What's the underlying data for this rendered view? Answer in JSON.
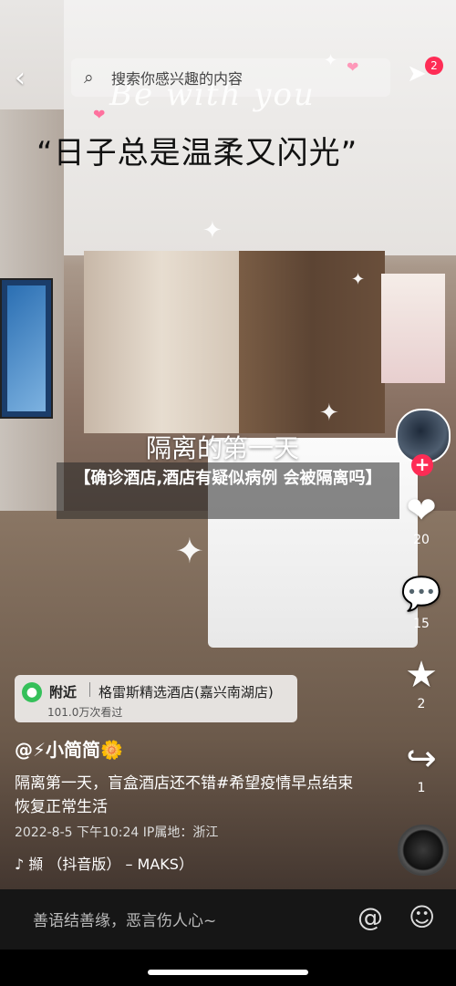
{
  "top": {
    "search_placeholder": "搜索你感兴趣的内容",
    "notification_count": "2"
  },
  "overlay": {
    "title": "Be with you",
    "quote": "“日子总是温柔又闪光”",
    "first_day": "隔离的第一天",
    "headline": "【确诊酒店,酒店有疑似病例 会被隔离吗】"
  },
  "rail": {
    "like_count": "20",
    "comment_count": "15",
    "favorite_count": "2",
    "share_count": "1"
  },
  "location": {
    "near_label": "附近",
    "hotel_name": "格雷斯精选酒店(嘉兴南湖店)",
    "views": "101.0万次看过"
  },
  "post": {
    "author": "@⚡小简简🌼",
    "description": "隔离第一天，盲盒酒店还不错#希望疫情早点结束恢复正常生活",
    "meta": "2022-8-5 下午10:24 IP属地：浙江",
    "music": "♪ 㩪 （抖音版） – MAKS）"
  },
  "comment_bar": {
    "placeholder": "善语结善缘，恶言伤人心~",
    "at_symbol": "@",
    "emoji_symbol": "☺"
  },
  "icons": {
    "back": "‹",
    "search": "⌕",
    "share": "➤",
    "heart": "❤",
    "comment": "💬",
    "star": "★",
    "forward": "↪",
    "pin": "●",
    "plus": "+"
  },
  "colors": {
    "accent_red": "#fe2c55",
    "location_green": "#35c05a"
  }
}
